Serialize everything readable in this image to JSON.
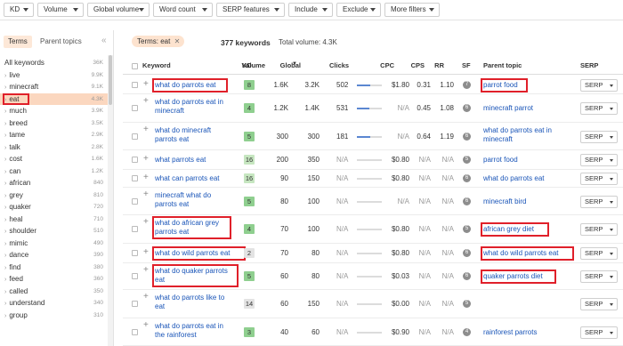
{
  "filters": [
    "KD",
    "Volume",
    "Global volume",
    "Word count",
    "SERP features",
    "Include",
    "Exclude",
    "More filters"
  ],
  "left_panel": {
    "tabs": [
      "Terms",
      "Parent topics"
    ],
    "collapse_icon": "double-chevron-left-icon",
    "items": [
      {
        "label": "All keywords",
        "count": "36K",
        "chevron": false,
        "selected": false
      },
      {
        "label": "live",
        "count": "9.9K",
        "chevron": true,
        "selected": false
      },
      {
        "label": "minecraft",
        "count": "9.1K",
        "chevron": true,
        "selected": false
      },
      {
        "label": "eat",
        "count": "4.3K",
        "chevron": true,
        "selected": true
      },
      {
        "label": "much",
        "count": "3.9K",
        "chevron": true,
        "selected": false
      },
      {
        "label": "breed",
        "count": "3.5K",
        "chevron": true,
        "selected": false
      },
      {
        "label": "tame",
        "count": "2.9K",
        "chevron": true,
        "selected": false
      },
      {
        "label": "talk",
        "count": "2.8K",
        "chevron": true,
        "selected": false
      },
      {
        "label": "cost",
        "count": "1.6K",
        "chevron": true,
        "selected": false
      },
      {
        "label": "can",
        "count": "1.2K",
        "chevron": true,
        "selected": false
      },
      {
        "label": "african",
        "count": "840",
        "chevron": true,
        "selected": false
      },
      {
        "label": "grey",
        "count": "810",
        "chevron": true,
        "selected": false
      },
      {
        "label": "quaker",
        "count": "720",
        "chevron": true,
        "selected": false
      },
      {
        "label": "heal",
        "count": "710",
        "chevron": true,
        "selected": false
      },
      {
        "label": "shoulder",
        "count": "510",
        "chevron": true,
        "selected": false
      },
      {
        "label": "mimic",
        "count": "490",
        "chevron": true,
        "selected": false
      },
      {
        "label": "dance",
        "count": "390",
        "chevron": true,
        "selected": false
      },
      {
        "label": "find",
        "count": "380",
        "chevron": true,
        "selected": false
      },
      {
        "label": "feed",
        "count": "360",
        "chevron": true,
        "selected": false
      },
      {
        "label": "called",
        "count": "350",
        "chevron": true,
        "selected": false
      },
      {
        "label": "understand",
        "count": "340",
        "chevron": true,
        "selected": false
      },
      {
        "label": "group",
        "count": "310",
        "chevron": true,
        "selected": false
      }
    ]
  },
  "header": {
    "chip": "Terms: eat",
    "keyword_count": "377 keywords",
    "total_volume": "Total volume: 4.3K"
  },
  "columns": [
    "Keyword",
    "KD",
    "Volume",
    "Global",
    "Clicks",
    "CPC",
    "CPS",
    "RR",
    "SF",
    "Parent topic",
    "SERP"
  ],
  "volume_sort_icon": "sort-desc-icon",
  "colors": {
    "kd_green": "#8fcf8f",
    "kd_light_green": "#c6e6c0",
    "kd_gray": "#e3e3e3",
    "link": "#1a55b8",
    "highlight": "#e0202a"
  },
  "rows": [
    {
      "keyword": [
        "what do parrots eat"
      ],
      "kd": "8",
      "kd_color": "green",
      "volume": "1.6K",
      "global": "3.2K",
      "clicks": "502",
      "trend": 0.55,
      "cpc": "$1.80",
      "cps": "0.31",
      "rr": "1.10",
      "sf": "7",
      "parent": [
        "parrot food"
      ],
      "serp": "SERP",
      "hl_kw": true,
      "hl_parent": true
    },
    {
      "keyword": [
        "what do parrots eat in",
        "minecraft"
      ],
      "kd": "4",
      "kd_color": "green",
      "volume": "1.2K",
      "global": "1.4K",
      "clicks": "531",
      "trend": 0.5,
      "cpc": "N/A",
      "cps": "0.45",
      "rr": "1.08",
      "sf": "6",
      "parent": [
        "minecraft parrot"
      ],
      "serp": "SERP",
      "hl_kw": false,
      "hl_parent": false
    },
    {
      "keyword": [
        "what do minecraft",
        "parrots eat"
      ],
      "kd": "5",
      "kd_color": "green",
      "volume": "300",
      "global": "300",
      "clicks": "181",
      "trend": 0.55,
      "cpc": "N/A",
      "cps": "0.64",
      "rr": "1.19",
      "sf": "6",
      "parent": [
        "what do parrots eat in",
        "minecraft"
      ],
      "serp": "SERP",
      "hl_kw": false,
      "hl_parent": false
    },
    {
      "keyword": [
        "what parrots eat"
      ],
      "kd": "16",
      "kd_color": "light",
      "volume": "200",
      "global": "350",
      "clicks": "N/A",
      "trend": null,
      "cpc": "$0.80",
      "cps": "N/A",
      "rr": "N/A",
      "sf": "5",
      "parent": [
        "parrot food"
      ],
      "serp": "SERP",
      "hl_kw": false,
      "hl_parent": false
    },
    {
      "keyword": [
        "what can parrots eat"
      ],
      "kd": "16",
      "kd_color": "light",
      "volume": "90",
      "global": "150",
      "clicks": "N/A",
      "trend": null,
      "cpc": "$0.80",
      "cps": "N/A",
      "rr": "N/A",
      "sf": "6",
      "parent": [
        "what do parrots eat"
      ],
      "serp": "SERP",
      "hl_kw": false,
      "hl_parent": false
    },
    {
      "keyword": [
        "minecraft what do",
        "parrots eat"
      ],
      "kd": "5",
      "kd_color": "green",
      "volume": "80",
      "global": "100",
      "clicks": "N/A",
      "trend": null,
      "cpc": "N/A",
      "cps": "N/A",
      "rr": "N/A",
      "sf": "6",
      "parent": [
        "minecraft bird"
      ],
      "serp": "SERP",
      "hl_kw": false,
      "hl_parent": false
    },
    {
      "keyword": [
        "what do african grey",
        "parrots eat"
      ],
      "kd": "4",
      "kd_color": "green",
      "volume": "70",
      "global": "100",
      "clicks": "N/A",
      "trend": null,
      "cpc": "$0.80",
      "cps": "N/A",
      "rr": "N/A",
      "sf": "5",
      "parent": [
        "african grey diet"
      ],
      "serp": "SERP",
      "hl_kw": true,
      "hl_parent": true
    },
    {
      "keyword": [
        "what do wild parrots eat"
      ],
      "kd": "2",
      "kd_color": "gray",
      "volume": "70",
      "global": "80",
      "clicks": "N/A",
      "trend": null,
      "cpc": "$0.80",
      "cps": "N/A",
      "rr": "N/A",
      "sf": "6",
      "parent": [
        "what do wild parrots eat"
      ],
      "serp": "SERP",
      "hl_kw": true,
      "hl_parent": true
    },
    {
      "keyword": [
        "what do quaker parrots",
        "eat"
      ],
      "kd": "5",
      "kd_color": "green",
      "volume": "60",
      "global": "80",
      "clicks": "N/A",
      "trend": null,
      "cpc": "$0.03",
      "cps": "N/A",
      "rr": "N/A",
      "sf": "6",
      "parent": [
        "quaker parrots diet"
      ],
      "serp": "SERP",
      "hl_kw": true,
      "hl_parent": true
    },
    {
      "keyword": [
        "what do parrots like to",
        "eat"
      ],
      "kd": "14",
      "kd_color": "gray",
      "volume": "60",
      "global": "150",
      "clicks": "N/A",
      "trend": null,
      "cpc": "$0.00",
      "cps": "N/A",
      "rr": "N/A",
      "sf": "5",
      "parent": [],
      "serp": "SERP",
      "hl_kw": false,
      "hl_parent": false
    },
    {
      "keyword": [
        "what do parrots eat in",
        "the rainforest"
      ],
      "kd": "3",
      "kd_color": "green",
      "volume": "40",
      "global": "60",
      "clicks": "N/A",
      "trend": null,
      "cpc": "$0.90",
      "cps": "N/A",
      "rr": "N/A",
      "sf": "4",
      "parent": [
        "rainforest parrots"
      ],
      "serp": "SERP",
      "hl_kw": false,
      "hl_parent": false
    }
  ]
}
